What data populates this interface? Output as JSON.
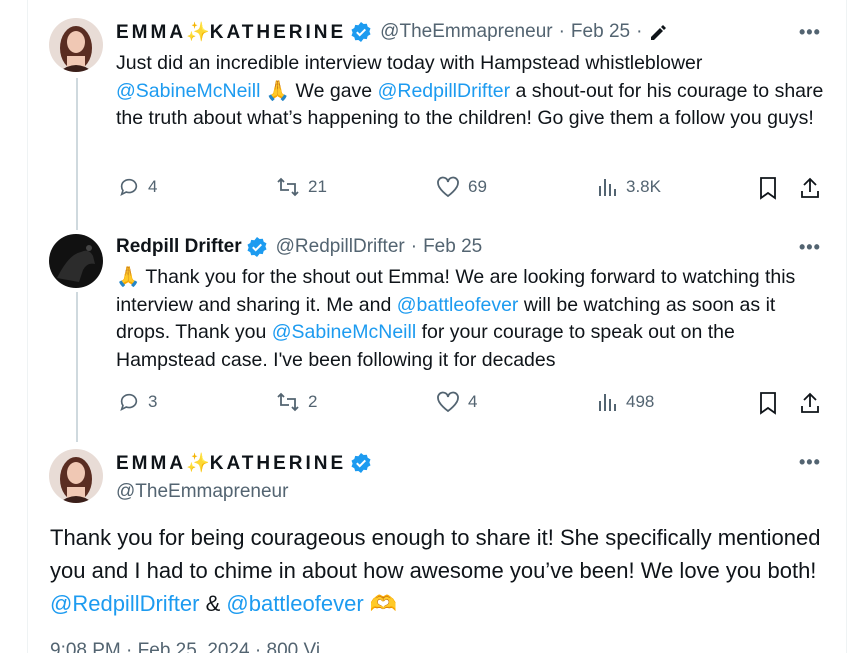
{
  "tweet1": {
    "name_prefix": "EMMA",
    "name_emoji": "✨",
    "name_suffix": "KATHERINE",
    "handle": "@TheEmmapreneur",
    "sep": "·",
    "date": "Feb 25",
    "sep2": "·",
    "edited_icon": "pencil-icon",
    "text_1": "Just did an incredible interview today with Hampstead whistleblower ",
    "mention_1": "@SabineMcNeill",
    "text_2": " 🙏 We gave ",
    "mention_2": "@RedpillDrifter",
    "text_3": " a shout-out for his courage to share the truth about what’s happening to the children! Go give them a follow you guys!",
    "replies": "4",
    "reposts": "21",
    "likes": "69",
    "views": "3.8K"
  },
  "tweet2": {
    "name": "Redpill Drifter",
    "handle": "@RedpillDrifter",
    "sep": "·",
    "date": "Feb 25",
    "text_1": "🙏 Thank you for the shout out Emma! We are looking forward to watching this interview and sharing it. Me and ",
    "mention_1": "@battleofever",
    "text_2": " will be watching as soon as it drops. Thank you ",
    "mention_2": "@SabineMcNeill",
    "text_3": " for your courage to speak out on the Hampstead case. I've been following it for decades",
    "replies": "3",
    "reposts": "2",
    "likes": "4",
    "views": "498"
  },
  "tweet3": {
    "name_prefix": "EMMA",
    "name_emoji": "✨",
    "name_suffix": "KATHERINE",
    "handle": "@TheEmmapreneur",
    "text_1": "Thank you for being courageous enough to share it! She specifically mentioned you and I had to chime in about how awesome you’ve been! We love you both! ",
    "mention_1": "@RedpillDrifter",
    "text_2": " & ",
    "mention_2": "@battleofever",
    "text_3": " 🫶",
    "meta_partial": "9:08 PM · Feb 25, 2024 · 800 Vi"
  },
  "more_label": "•••",
  "colors": {
    "accent": "#1d9bf0",
    "muted": "#536471",
    "text": "#0f1419",
    "line": "#cfd9de"
  }
}
